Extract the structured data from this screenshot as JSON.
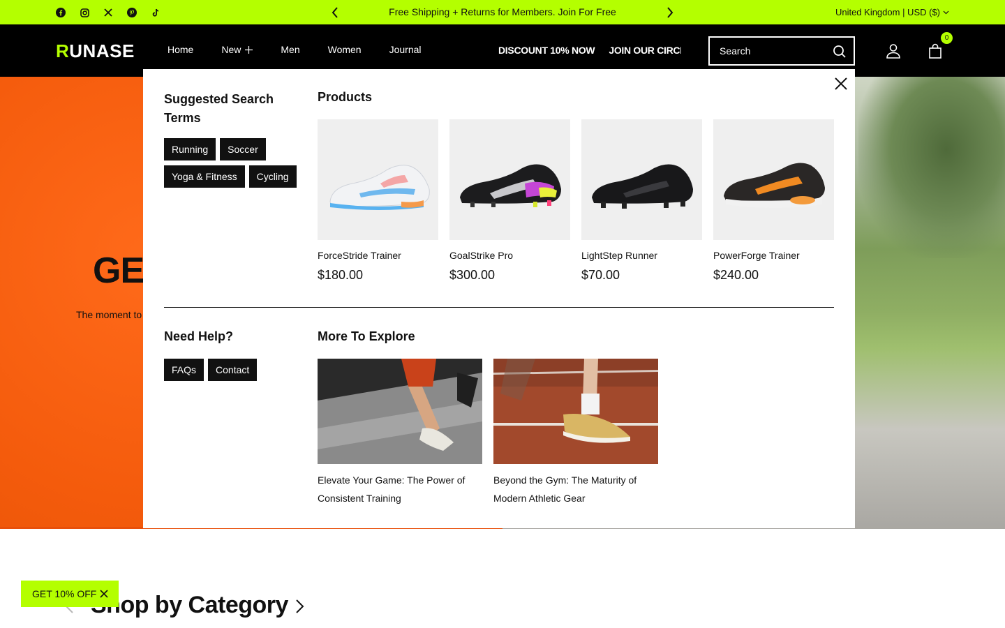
{
  "announcement": {
    "message": "Free Shipping + Returns for Members. Join For Free",
    "locale": "United Kingdom | USD ($)",
    "social_icons": [
      "facebook-icon",
      "instagram-icon",
      "x-icon",
      "pinterest-icon",
      "tiktok-icon"
    ]
  },
  "header": {
    "logo": "RUNASE",
    "nav": [
      "Home",
      "New",
      "Men",
      "Women",
      "Journal"
    ],
    "ticker": [
      "DISCOUNT 10% NOW",
      "JOIN OUR CIRCLE"
    ],
    "search_placeholder": "Search",
    "cart_count": "0"
  },
  "hero": {
    "title": "GE",
    "subtitle": "The moment to"
  },
  "search_panel": {
    "suggested_title": "Suggested Search Terms",
    "suggested_terms": [
      "Running",
      "Soccer",
      "Yoga & Fitness",
      "Cycling"
    ],
    "products_title": "Products",
    "products": [
      {
        "name": "ForceStride Trainer",
        "price": "$180.00"
      },
      {
        "name": "GoalStrike Pro",
        "price": "$300.00"
      },
      {
        "name": "LightStep Runner",
        "price": "$70.00"
      },
      {
        "name": "PowerForge Trainer",
        "price": "$240.00"
      }
    ],
    "help_title": "Need Help?",
    "help_links": [
      "FAQs",
      "Contact"
    ],
    "explore_title": "More To Explore",
    "articles": [
      {
        "title": "Elevate Your Game: The Power of Consistent Training"
      },
      {
        "title": "Beyond the Gym: The Maturity of Modern Athletic Gear"
      }
    ]
  },
  "promo": {
    "label": "GET 10% OFF"
  },
  "category": {
    "title": "Shop by Category"
  },
  "colors": {
    "accent": "#b4ff00",
    "dark": "#111111",
    "hero_orange": "#f45b0c"
  }
}
